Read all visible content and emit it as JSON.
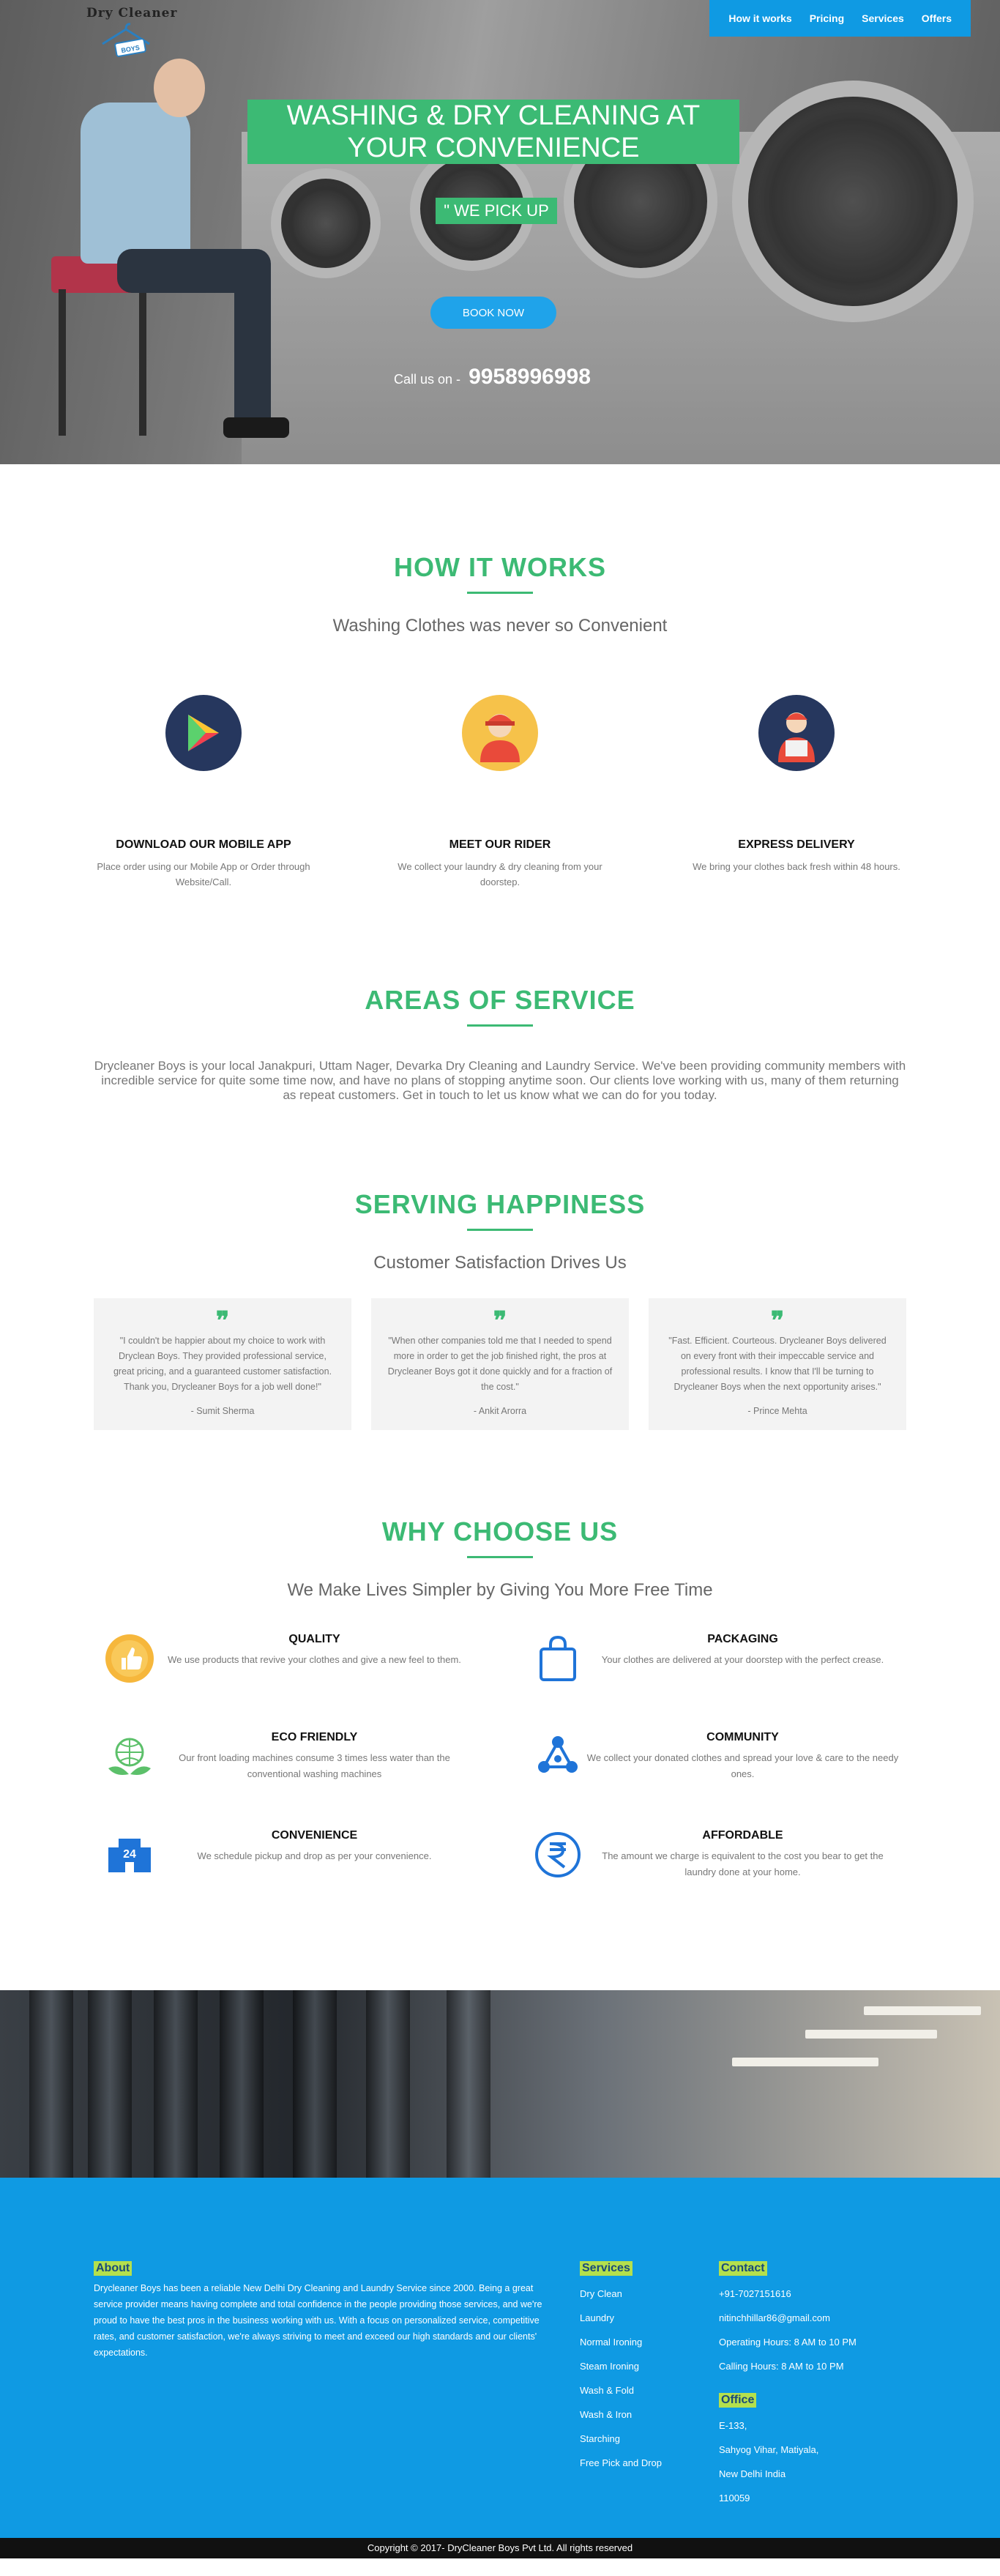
{
  "brand": {
    "name": "Dry Cleaner",
    "badge": "BOYS"
  },
  "nav": [
    {
      "label": "How it works"
    },
    {
      "label": "Pricing"
    },
    {
      "label": "Services"
    },
    {
      "label": "Offers"
    }
  ],
  "hero": {
    "title_line1": "WASHING & DRY CLEANING AT",
    "title_line2": "YOUR CONVENIENCE",
    "tagline": "\" WE PICK UP",
    "book_button": "BOOK NOW",
    "call_prefix": "Call us on -",
    "phone": "9958996998"
  },
  "how_it_works": {
    "title": "HOW IT WORKS",
    "subtitle": "Washing Clothes was never so Convenient",
    "steps": [
      {
        "icon": "play-store-icon",
        "title": "DOWNLOAD OUR MOBILE APP",
        "text": "Place order using our Mobile App or Order through Website/Call."
      },
      {
        "icon": "rider-icon",
        "title": "MEET OUR RIDER",
        "text": "We collect your laundry & dry cleaning from your doorstep."
      },
      {
        "icon": "delivery-icon",
        "title": "EXPRESS DELIVERY",
        "text": "We bring your clothes back fresh within 48 hours."
      }
    ]
  },
  "areas": {
    "title": "AREAS OF SERVICE",
    "text": "Drycleaner Boys is your local Janakpuri, Uttam Nager, Devarka Dry Cleaning and Laundry Service. We've been providing community members with incredible service for quite some time now, and have no plans of stopping anytime soon. Our clients love working with us, many of them returning as repeat customers. Get in touch to let us know what we can do for you today."
  },
  "happiness": {
    "title": "SERVING HAPPINESS",
    "subtitle": "Customer Satisfaction Drives Us",
    "testimonials": [
      {
        "quote": "\"I couldn't be happier about my choice to work with Dryclean Boys. They provided professional service, great pricing, and a guaranteed customer satisfaction. Thank you, Drycleaner Boys for a job well done!\"",
        "author": "- Sumit Sherma"
      },
      {
        "quote": "\"When other companies told me that I needed to spend more in order to get the job finished right, the pros at Drycleaner Boys got it done quickly and for a fraction of the cost.\"",
        "author": "- Ankit Arorra"
      },
      {
        "quote": "\"Fast. Efficient. Courteous. Drycleaner Boys delivered on every front with their impeccable service and professional results. I know that I'll be turning to Drycleaner Boys when the next opportunity arises.\"",
        "author": "- Prince Mehta"
      }
    ]
  },
  "why": {
    "title": "WHY CHOOSE US",
    "subtitle": "We Make Lives Simpler by Giving You More Free Time",
    "items": [
      {
        "icon": "thumbs-up-badge-icon",
        "title": "QUALITY",
        "text": "We use products that revive your clothes and give a new feel to them."
      },
      {
        "icon": "shopping-bag-icon",
        "title": "PACKAGING",
        "text": "Your clothes are delivered at your doorstep with the perfect crease."
      },
      {
        "icon": "eco-globe-icon",
        "title": "ECO FRIENDLY",
        "text": "Our front loading machines consume 3 times less water than the conventional washing machines"
      },
      {
        "icon": "community-icon",
        "title": "COMMUNITY",
        "text": "We collect your donated clothes and spread your love & care to the needy ones."
      },
      {
        "icon": "24-hours-icon",
        "title": "CONVENIENCE",
        "text": "We schedule pickup and drop as per your convenience."
      },
      {
        "icon": "rupee-icon",
        "title": "AFFORDABLE",
        "text": "The amount we charge is equivalent to the cost you bear to get the laundry done at your home."
      }
    ]
  },
  "footer": {
    "about_title": "About",
    "about_text": "Drycleaner Boys has been a reliable New Delhi Dry Cleaning and Laundry Service since 2000. Being a great service provider means having complete and total confidence in the people providing those services, and we're proud to have the best pros in the business working with us. With a focus on personalized service, competitive rates, and customer satisfaction, we're always striving to meet and exceed our high standards and our clients' expectations.",
    "services_title": "Services",
    "services": [
      "Dry Clean",
      "Laundry",
      "Normal Ironing",
      "Steam Ironing",
      "Wash & Fold",
      "Wash & Iron",
      "Starching",
      "Free Pick and Drop"
    ],
    "contact_title": "Contact",
    "contact": [
      "+91-7027151616",
      "nitinchhillar86@gmail.com",
      "Operating Hours: 8 AM to 10 PM",
      "Calling Hours: 8 AM to 10 PM"
    ],
    "office_title": "Office",
    "office": [
      "E-133,",
      "Sahyog Vihar, Matiyala,",
      "New Delhi India",
      "110059"
    ],
    "copyright": "Copyright © 2017- DryCleaner Boys Pvt Ltd. All rights reserved"
  },
  "colors": {
    "green": "#3cba74",
    "blue": "#0f9ae3",
    "highlight": "#b4e04d"
  }
}
